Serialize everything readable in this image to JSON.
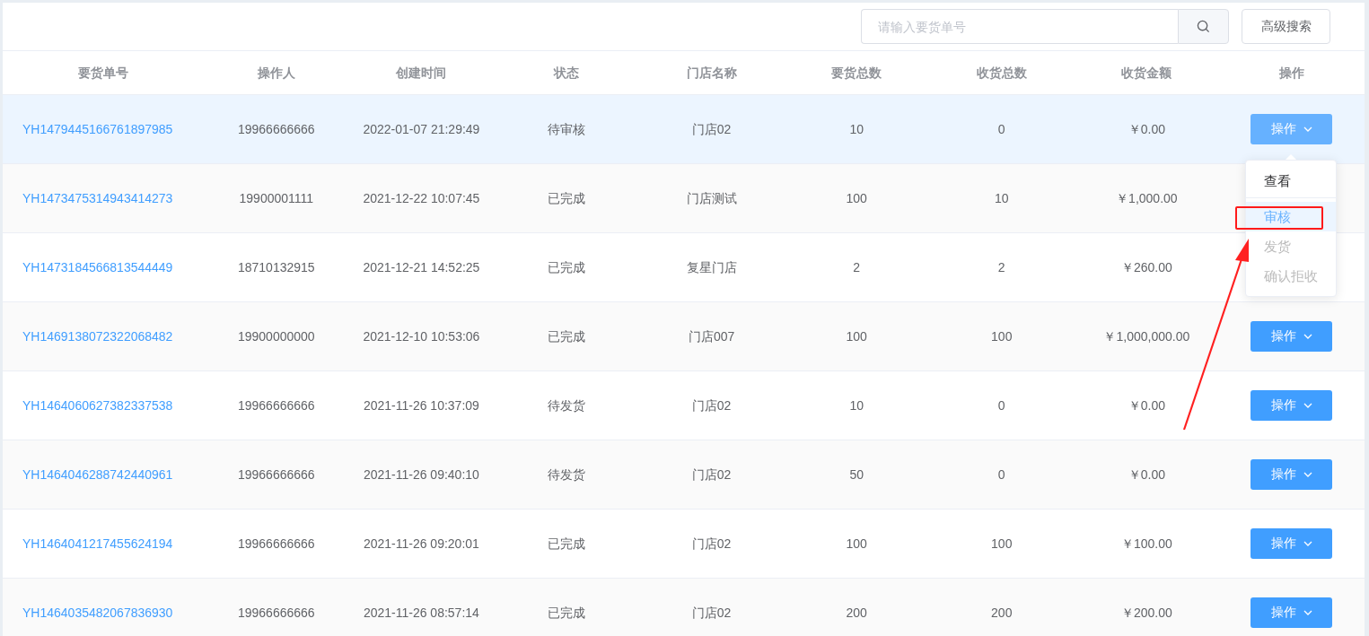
{
  "search": {
    "placeholder": "请输入要货单号"
  },
  "advanced_search": "高级搜索",
  "table": {
    "columns": [
      "要货单号",
      "操作人",
      "创建时间",
      "状态",
      "门店名称",
      "要货总数",
      "收货总数",
      "收货金额",
      "操作"
    ],
    "rows": [
      {
        "order_no": "YH1479445166761897985",
        "operator": "19966666666",
        "created": "2022-01-07 21:29:49",
        "status": "待审核",
        "store": "门店02",
        "requested": "10",
        "received": "0",
        "amount": "￥0.00",
        "selected": true,
        "action": {
          "label": "操作",
          "active": true
        }
      },
      {
        "order_no": "YH1473475314943414273",
        "operator": "19900001111",
        "created": "2021-12-22 10:07:45",
        "status": "已完成",
        "store": "门店测试",
        "requested": "100",
        "received": "10",
        "amount": "￥1,000.00",
        "selected": false
      },
      {
        "order_no": "YH1473184566813544449",
        "operator": "18710132915",
        "created": "2021-12-21 14:52:25",
        "status": "已完成",
        "store": "复星门店",
        "requested": "2",
        "received": "2",
        "amount": "￥260.00",
        "selected": false
      },
      {
        "order_no": "YH1469138072322068482",
        "operator": "19900000000",
        "created": "2021-12-10 10:53:06",
        "status": "已完成",
        "store": "门店007",
        "requested": "100",
        "received": "100",
        "amount": "￥1,000,000.00",
        "selected": false,
        "action": {
          "label": "操作",
          "active": false
        }
      },
      {
        "order_no": "YH1464060627382337538",
        "operator": "19966666666",
        "created": "2021-11-26 10:37:09",
        "status": "待发货",
        "store": "门店02",
        "requested": "10",
        "received": "0",
        "amount": "￥0.00",
        "selected": false,
        "action": {
          "label": "操作",
          "active": false
        }
      },
      {
        "order_no": "YH1464046288742440961",
        "operator": "19966666666",
        "created": "2021-11-26 09:40:10",
        "status": "待发货",
        "store": "门店02",
        "requested": "50",
        "received": "0",
        "amount": "￥0.00",
        "selected": false,
        "action": {
          "label": "操作",
          "active": false
        }
      },
      {
        "order_no": "YH1464041217455624194",
        "operator": "19966666666",
        "created": "2021-11-26 09:20:01",
        "status": "已完成",
        "store": "门店02",
        "requested": "100",
        "received": "100",
        "amount": "￥100.00",
        "selected": false,
        "action": {
          "label": "操作",
          "active": false
        }
      },
      {
        "order_no": "YH1464035482067836930",
        "operator": "19966666666",
        "created": "2021-11-26 08:57:14",
        "status": "已完成",
        "store": "门店02",
        "requested": "200",
        "received": "200",
        "amount": "￥200.00",
        "selected": false,
        "action": {
          "label": "操作",
          "active": false
        }
      }
    ]
  },
  "dropdown": {
    "items": [
      {
        "label": "查看",
        "selected": false,
        "disabled": false
      },
      {
        "label": "审核",
        "selected": true,
        "disabled": false
      },
      {
        "label": "发货",
        "selected": false,
        "disabled": true
      },
      {
        "label": "确认拒收",
        "selected": false,
        "disabled": true
      }
    ]
  }
}
